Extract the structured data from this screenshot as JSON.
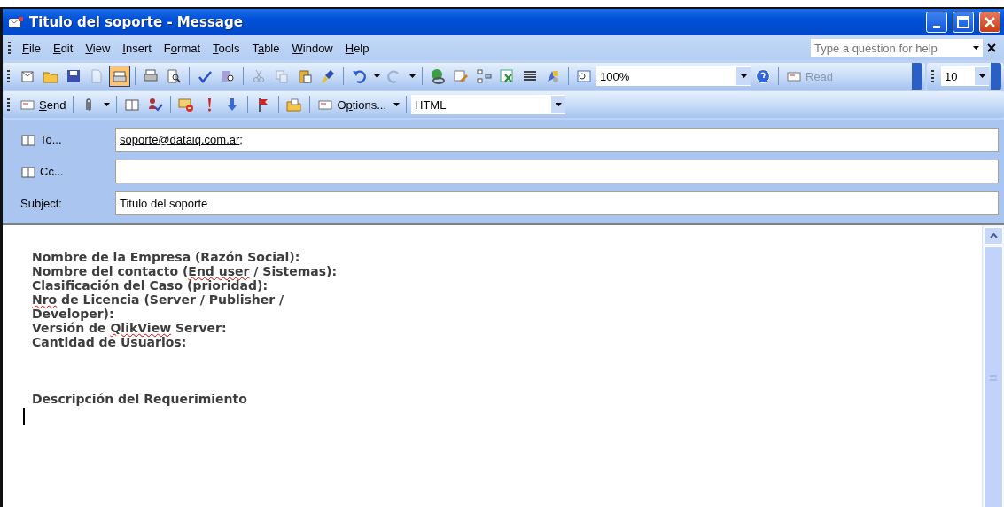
{
  "window": {
    "title": "Titulo del soporte - Message"
  },
  "menu": [
    {
      "label": [
        {
          "text": "F",
          "accel": true
        },
        {
          "text": "ile"
        }
      ]
    },
    {
      "label": [
        {
          "text": "E",
          "accel": true
        },
        {
          "text": "dit"
        }
      ]
    },
    {
      "label": [
        {
          "text": "V",
          "accel": true
        },
        {
          "text": "iew"
        }
      ]
    },
    {
      "label": [
        {
          "text": "I",
          "accel": true
        },
        {
          "text": "nsert"
        }
      ]
    },
    {
      "label": [
        {
          "text": "F"
        },
        {
          "text": "o",
          "accel": true
        },
        {
          "text": "rmat"
        }
      ]
    },
    {
      "label": [
        {
          "text": "T",
          "accel": true
        },
        {
          "text": "ools"
        }
      ]
    },
    {
      "label": [
        {
          "text": "T"
        },
        {
          "text": "a",
          "accel": true
        },
        {
          "text": "ble"
        }
      ]
    },
    {
      "label": [
        {
          "text": "W",
          "accel": true
        },
        {
          "text": "indow"
        }
      ]
    },
    {
      "label": [
        {
          "text": "H",
          "accel": true
        },
        {
          "text": "elp"
        }
      ]
    }
  ],
  "help_box": {
    "placeholder": "Type a question for help"
  },
  "toolbar_standard": [
    {
      "kind": "icon",
      "pressed": false
    },
    {
      "kind": "icon",
      "pressed": false
    },
    {
      "kind": "icon",
      "pressed": false
    },
    {
      "kind": "icon",
      "pressed": false,
      "disabled": true
    },
    {
      "kind": "icon",
      "pressed": true
    },
    {
      "kind": "separator"
    },
    {
      "kind": "icon",
      "pressed": false
    },
    {
      "kind": "icon",
      "pressed": false
    },
    {
      "kind": "separator"
    },
    {
      "kind": "icon",
      "pressed": false
    },
    {
      "kind": "icon",
      "pressed": false
    },
    {
      "kind": "separator"
    },
    {
      "kind": "icon",
      "pressed": false,
      "disabled": true
    },
    {
      "kind": "icon",
      "pressed": false,
      "disabled": true
    },
    {
      "kind": "icon",
      "pressed": false
    },
    {
      "kind": "icon",
      "pressed": false
    },
    {
      "kind": "separator"
    },
    {
      "kind": "icon",
      "pressed": false
    },
    {
      "kind": "caret"
    },
    {
      "kind": "icon",
      "pressed": false,
      "disabled": true
    },
    {
      "kind": "caret"
    },
    {
      "kind": "separator"
    },
    {
      "kind": "icon",
      "pressed": false
    },
    {
      "kind": "icon",
      "pressed": false
    },
    {
      "kind": "icon",
      "pressed": false
    },
    {
      "kind": "icon",
      "pressed": false
    },
    {
      "kind": "icon",
      "pressed": false
    },
    {
      "kind": "icon",
      "pressed": false
    },
    {
      "kind": "separator"
    },
    {
      "kind": "icon",
      "pressed": false
    },
    {
      "kind": "combo",
      "value": "100%"
    },
    {
      "kind": "icon",
      "pressed": false
    },
    {
      "kind": "separator"
    },
    {
      "kind": "button",
      "label": [
        {
          "text": "R",
          "accel": true
        },
        {
          "text": "ead"
        }
      ],
      "disabled": true
    }
  ],
  "toolbar_font_size": {
    "value": "10"
  },
  "toolbar_email": [
    {
      "kind": "button",
      "label": [
        {
          "text": "S",
          "accel": true
        },
        {
          "text": "end"
        }
      ]
    },
    {
      "kind": "separator"
    },
    {
      "kind": "icon",
      "pressed": false
    },
    {
      "kind": "caret"
    },
    {
      "kind": "separator"
    },
    {
      "kind": "icon",
      "pressed": false
    },
    {
      "kind": "icon",
      "pressed": false
    },
    {
      "kind": "separator"
    },
    {
      "kind": "icon",
      "pressed": false
    },
    {
      "kind": "icon",
      "pressed": false
    },
    {
      "kind": "icon",
      "pressed": false
    },
    {
      "kind": "separator"
    },
    {
      "kind": "icon",
      "pressed": false
    },
    {
      "kind": "separator"
    },
    {
      "kind": "icon",
      "pressed": false
    },
    {
      "kind": "separator"
    },
    {
      "kind": "button",
      "label": [
        {
          "text": "O"
        },
        {
          "text": "p",
          "accel": true
        },
        {
          "text": "tions..."
        }
      ]
    },
    {
      "kind": "caret"
    },
    {
      "kind": "separator"
    },
    {
      "kind": "combo",
      "value": "HTML"
    }
  ],
  "fields": [
    {
      "label": "To...",
      "kind": "address",
      "value": "soporte@dataiq.com.ar",
      "suffix": ";"
    },
    {
      "label": "Cc...",
      "kind": "address"
    },
    {
      "label": "Subject:",
      "kind": "text",
      "value": "Titulo del soporte"
    }
  ],
  "body": {
    "paragraphs": [
      {
        "segments": [
          {
            "text": "Nombre de la Empresa (Razón Social):"
          }
        ]
      },
      {
        "segments": [
          {
            "text": "Nombre del contacto ("
          },
          {
            "text": "End user",
            "misspelled": true
          },
          {
            "text": " / Sistemas):"
          }
        ]
      },
      {
        "segments": [
          {
            "text": "Clasificación del Caso (prioridad):"
          }
        ]
      },
      {
        "segments": [
          {
            "text": "Nro",
            "misspelled": true
          },
          {
            "text": " de Licencia (Server / Publisher / Developer):"
          }
        ]
      },
      {
        "segments": [
          {
            "text": "Versión de "
          },
          {
            "text": "QlikView",
            "misspelled": true
          },
          {
            "text": " Server:"
          }
        ]
      },
      {
        "segments": [
          {
            "text": "Cantidad de Usuarios:"
          }
        ]
      },
      {
        "segments": [
          {
            "text": "Descripción del Requerimiento"
          }
        ],
        "gap_before": true
      }
    ]
  }
}
